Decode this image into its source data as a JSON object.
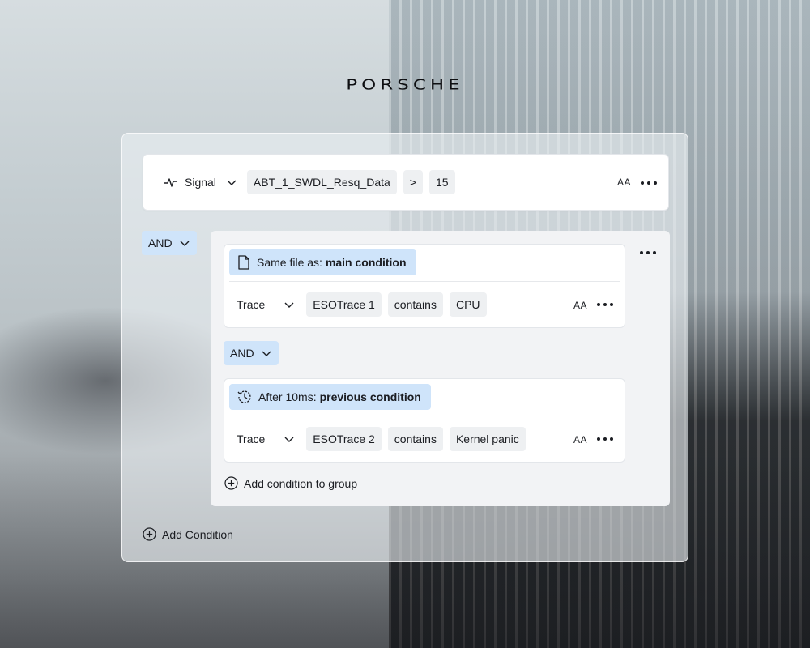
{
  "brand": {
    "logo_text": "PORSCHE"
  },
  "main_condition": {
    "type_label": "Signal",
    "signal_name": "ABT_1_SWDL_Resq_Data",
    "operator": ">",
    "value": "15",
    "case_label": "AA"
  },
  "group_operator": "AND",
  "group": {
    "conditions": [
      {
        "badge_prefix": "Same file as:",
        "badge_target": "main condition",
        "type_label": "Trace",
        "source": "ESOTrace 1",
        "operator": "contains",
        "value": "CPU",
        "case_label": "AA"
      },
      {
        "badge_prefix": "After 10ms:",
        "badge_target": "previous condition",
        "type_label": "Trace",
        "source": "ESOTrace 2",
        "operator": "contains",
        "value": "Kernel panic",
        "case_label": "AA"
      }
    ],
    "inner_operator": "AND",
    "add_label": "Add condition to group"
  },
  "add_condition_label": "Add Condition",
  "colors": {
    "accent_chip": "#cfe4fa",
    "chip": "#eef0f2"
  }
}
